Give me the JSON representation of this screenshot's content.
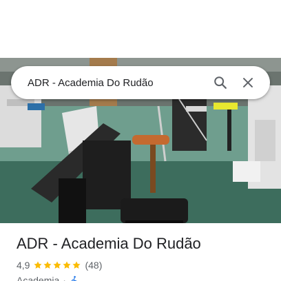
{
  "search": {
    "query": "ADR - Academia Do Rudão"
  },
  "place": {
    "title": "ADR - Academia Do Rudão",
    "rating": "4,9",
    "stars": 5,
    "review_count": "(48)",
    "category": "Academia",
    "separator": "·"
  },
  "icons": {
    "search": "search-icon",
    "close": "close-icon",
    "star": "star-icon",
    "accessibility": "wheelchair-accessible-icon"
  },
  "colors": {
    "star": "#fbbc04",
    "text_primary": "#202124",
    "text_secondary": "#5f6368",
    "icon": "#5f6368",
    "accessible_icon": "#1a73e8"
  }
}
